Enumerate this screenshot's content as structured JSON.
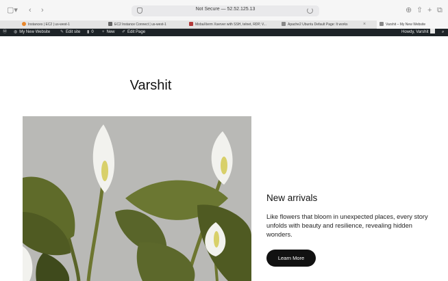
{
  "browser": {
    "address_text": "Not Secure — 52.52.125.13",
    "tabs": [
      {
        "label": "Instances | EC2 | us-west-1",
        "fav_color": "#e8862a"
      },
      {
        "label": "EC2 Instance Connect | us-west-1",
        "fav_color": "#666666"
      },
      {
        "label": "MobaXterm Xserver with SSH, telnet, RDP, V...",
        "fav_color": "#b23a3a"
      },
      {
        "label": "Apache2 Ubuntu Default Page: It works",
        "fav_color": "#888888"
      },
      {
        "label": "Varshit – My New Website",
        "fav_color": "#888888"
      }
    ],
    "tab_close_glyph": "×"
  },
  "admin_bar": {
    "site_name": "My New Website",
    "edit_site": "Edit site",
    "comments_count": "0",
    "new_label": "New",
    "edit_page": "Edit Page",
    "howdy": "Howdy, Varshit"
  },
  "page": {
    "site_title": "Varshit",
    "heading": "New arrivals",
    "description": "Like flowers that bloom in unexpected places, every story unfolds with beauty and resilience, revealing hidden wonders.",
    "button_label": "Learn More"
  },
  "colors": {
    "admin_bar": "#1d2327",
    "button": "#111111",
    "photo_bg": "#b9b9b6",
    "leaf": "#5f6b2a",
    "spathe": "#f2f2ee",
    "spadix": "#d8d06a"
  }
}
